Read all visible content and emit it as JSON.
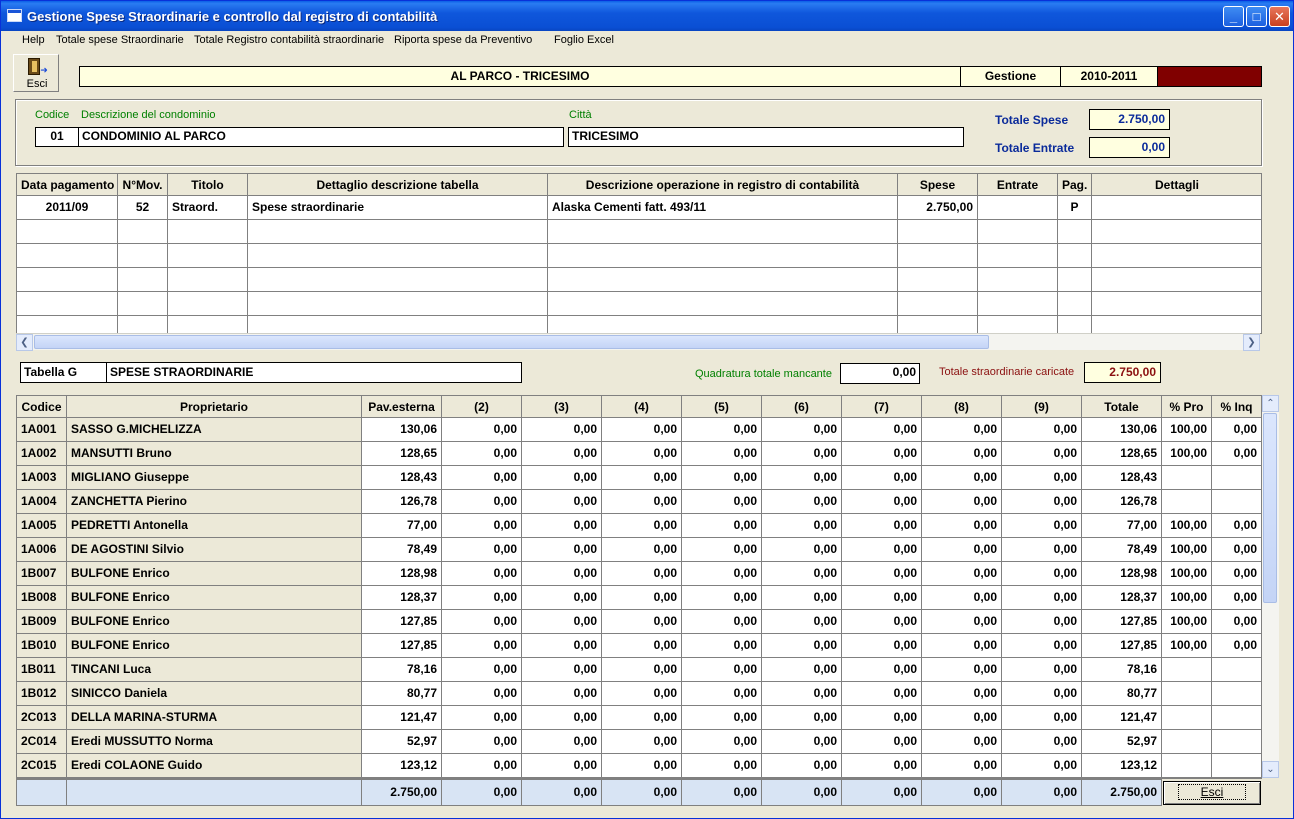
{
  "window": {
    "title": "Gestione Spese Straordinarie e controllo dal registro di contabilità",
    "min_glyph": "_",
    "max_glyph": "□",
    "close_glyph": "✕"
  },
  "menu": [
    {
      "label": "Help"
    },
    {
      "label": "Totale spese Straordinarie"
    },
    {
      "label": "Totale Registro contabilità straordinarie"
    },
    {
      "label": "Riporta spese da Preventivo"
    },
    {
      "label": "Foglio Excel"
    }
  ],
  "toolbar": {
    "esci_label": "Esci"
  },
  "header": {
    "title": "AL PARCO - TRICESIMO",
    "gestione_label": "Gestione",
    "year": "2010-2011",
    "accent_color": "#800000"
  },
  "info": {
    "codice_label": "Codice",
    "descrizione_label": "Descrizione del condominio",
    "citta_label": "Città",
    "codice": "01",
    "descrizione": "CONDOMINIO AL PARCO",
    "citta": "TRICESIMO",
    "totale_spese_label": "Totale Spese",
    "totale_spese": "2.750,00",
    "totale_entrate_label": "Totale Entrate",
    "totale_entrate": "0,00"
  },
  "movements": {
    "columns": [
      "Data pagamento",
      "N°Mov.",
      "Titolo",
      "Dettaglio descrizione tabella",
      "Descrizione operazione in registro di contabilità",
      "Spese",
      "Entrate",
      "Pag.",
      "Dettagli"
    ],
    "rows": [
      [
        "2011/09",
        "52",
        "Straord.",
        "Spese straordinarie",
        "Alaska Cementi fatt. 493/11",
        "2.750,00",
        "",
        "P",
        ""
      ],
      [
        "",
        "",
        "",
        "",
        "",
        "",
        "",
        "",
        ""
      ],
      [
        "",
        "",
        "",
        "",
        "",
        "",
        "",
        "",
        ""
      ],
      [
        "",
        "",
        "",
        "",
        "",
        "",
        "",
        "",
        ""
      ],
      [
        "",
        "",
        "",
        "",
        "",
        "",
        "",
        "",
        ""
      ],
      [
        "",
        "",
        "",
        "",
        "",
        "",
        "",
        "",
        ""
      ]
    ]
  },
  "tabella": {
    "code": "Tabella G",
    "name": "SPESE STRAORDINARIE",
    "quadratura_label": "Quadratura totale mancante",
    "quadratura_value": "0,00",
    "totale_caricate_label": "Totale straordinarie caricate",
    "totale_caricate_value": "2.750,00"
  },
  "owners": {
    "columns": [
      "Codice",
      "Proprietario",
      "Pav.esterna",
      "(2)",
      "(3)",
      "(4)",
      "(5)",
      "(6)",
      "(7)",
      "(8)",
      "(9)",
      "Totale",
      "% Pro",
      "% Inq"
    ],
    "rows": [
      [
        "1A001",
        "SASSO G.MICHELIZZA",
        "130,06",
        "0,00",
        "0,00",
        "0,00",
        "0,00",
        "0,00",
        "0,00",
        "0,00",
        "0,00",
        "130,06",
        "100,00",
        "0,00"
      ],
      [
        "1A002",
        "MANSUTTI Bruno",
        "128,65",
        "0,00",
        "0,00",
        "0,00",
        "0,00",
        "0,00",
        "0,00",
        "0,00",
        "0,00",
        "128,65",
        "100,00",
        "0,00"
      ],
      [
        "1A003",
        "MIGLIANO Giuseppe",
        "128,43",
        "0,00",
        "0,00",
        "0,00",
        "0,00",
        "0,00",
        "0,00",
        "0,00",
        "0,00",
        "128,43",
        "",
        ""
      ],
      [
        "1A004",
        "ZANCHETTA Pierino",
        "126,78",
        "0,00",
        "0,00",
        "0,00",
        "0,00",
        "0,00",
        "0,00",
        "0,00",
        "0,00",
        "126,78",
        "",
        ""
      ],
      [
        "1A005",
        "PEDRETTI Antonella",
        "77,00",
        "0,00",
        "0,00",
        "0,00",
        "0,00",
        "0,00",
        "0,00",
        "0,00",
        "0,00",
        "77,00",
        "100,00",
        "0,00"
      ],
      [
        "1A006",
        "DE AGOSTINI Silvio",
        "78,49",
        "0,00",
        "0,00",
        "0,00",
        "0,00",
        "0,00",
        "0,00",
        "0,00",
        "0,00",
        "78,49",
        "100,00",
        "0,00"
      ],
      [
        "1B007",
        "BULFONE Enrico",
        "128,98",
        "0,00",
        "0,00",
        "0,00",
        "0,00",
        "0,00",
        "0,00",
        "0,00",
        "0,00",
        "128,98",
        "100,00",
        "0,00"
      ],
      [
        "1B008",
        "BULFONE Enrico",
        "128,37",
        "0,00",
        "0,00",
        "0,00",
        "0,00",
        "0,00",
        "0,00",
        "0,00",
        "0,00",
        "128,37",
        "100,00",
        "0,00"
      ],
      [
        "1B009",
        "BULFONE Enrico",
        "127,85",
        "0,00",
        "0,00",
        "0,00",
        "0,00",
        "0,00",
        "0,00",
        "0,00",
        "0,00",
        "127,85",
        "100,00",
        "0,00"
      ],
      [
        "1B010",
        "BULFONE Enrico",
        "127,85",
        "0,00",
        "0,00",
        "0,00",
        "0,00",
        "0,00",
        "0,00",
        "0,00",
        "0,00",
        "127,85",
        "100,00",
        "0,00"
      ],
      [
        "1B011",
        "TINCANI Luca",
        "78,16",
        "0,00",
        "0,00",
        "0,00",
        "0,00",
        "0,00",
        "0,00",
        "0,00",
        "0,00",
        "78,16",
        "",
        ""
      ],
      [
        "1B012",
        "SINICCO Daniela",
        "80,77",
        "0,00",
        "0,00",
        "0,00",
        "0,00",
        "0,00",
        "0,00",
        "0,00",
        "0,00",
        "80,77",
        "",
        ""
      ],
      [
        "2C013",
        "DELLA MARINA-STURMA",
        "121,47",
        "0,00",
        "0,00",
        "0,00",
        "0,00",
        "0,00",
        "0,00",
        "0,00",
        "0,00",
        "121,47",
        "",
        ""
      ],
      [
        "2C014",
        "Eredi MUSSUTTO Norma",
        "52,97",
        "0,00",
        "0,00",
        "0,00",
        "0,00",
        "0,00",
        "0,00",
        "0,00",
        "0,00",
        "52,97",
        "",
        ""
      ],
      [
        "2C015",
        "Eredi COLAONE Guido",
        "123,12",
        "0,00",
        "0,00",
        "0,00",
        "0,00",
        "0,00",
        "0,00",
        "0,00",
        "0,00",
        "123,12",
        "",
        ""
      ]
    ],
    "totals": [
      "",
      "",
      "2.750,00",
      "0,00",
      "0,00",
      "0,00",
      "0,00",
      "0,00",
      "0,00",
      "0,00",
      "0,00",
      "2.750,00"
    ]
  },
  "footer": {
    "esci_label": "Esci"
  }
}
